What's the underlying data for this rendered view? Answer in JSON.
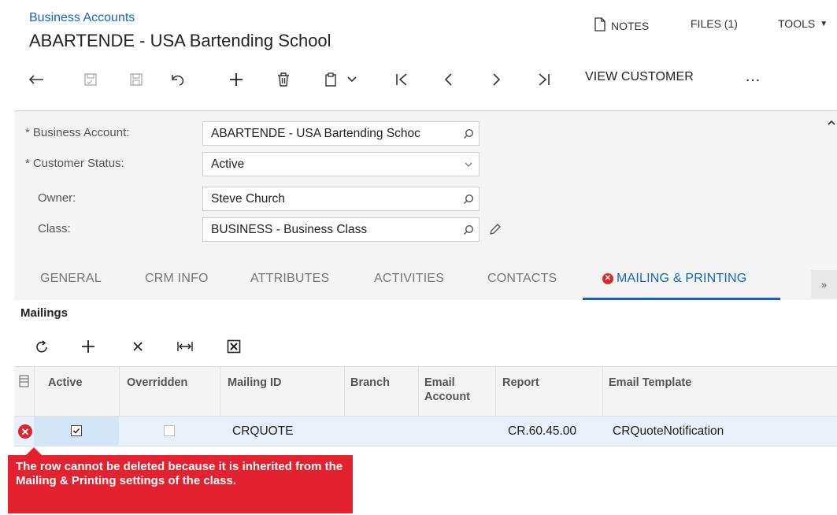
{
  "header": {
    "breadcrumb": "Business Accounts",
    "title": "ABARTENDE - USA Bartending School",
    "actions": {
      "notes": "NOTES",
      "files": "FILES (1)",
      "tools": "TOOLS"
    }
  },
  "toolbar": {
    "icons": [
      "back-arrow-icon",
      "save-and-close-icon",
      "save-icon",
      "undo-icon",
      "add-icon",
      "delete-icon",
      "copy-paste-icon",
      "first-record-icon",
      "previous-record-icon",
      "next-record-icon",
      "last-record-icon",
      "more-icon"
    ],
    "view_customer": "VIEW CUSTOMER",
    "more": "…"
  },
  "form": {
    "business_account": {
      "label": "Business Account:",
      "value": "ABARTENDE - USA Bartending Schoc"
    },
    "customer_status": {
      "label": "Customer Status:",
      "value": "Active"
    },
    "owner": {
      "label": "Owner:",
      "value": "Steve Church"
    },
    "class": {
      "label": "Class:",
      "value": "BUSINESS - Business Class"
    },
    "required_marker": "*"
  },
  "tabs": [
    {
      "label": "GENERAL",
      "active": false
    },
    {
      "label": "CRM INFO",
      "active": false
    },
    {
      "label": "ATTRIBUTES",
      "active": false
    },
    {
      "label": "ACTIVITIES",
      "active": false
    },
    {
      "label": "CONTACTS",
      "active": false
    },
    {
      "label": "MAILING & PRINTING",
      "active": true
    }
  ],
  "mailings": {
    "title": "Mailings",
    "tools": [
      "refresh-icon",
      "add-row-icon",
      "delete-row-icon",
      "fit-columns-icon",
      "export-excel-icon"
    ],
    "columns": [
      "Active",
      "Overridden",
      "Mailing ID",
      "Branch",
      "Email Account",
      "Report",
      "Email Template"
    ],
    "column_lines": {
      "email_account_1": "Email",
      "email_account_2": "Account"
    },
    "rows": [
      {
        "active": true,
        "overridden": false,
        "mailing_id": "CRQUOTE",
        "branch": "",
        "email_account": "",
        "report": "CR.60.45.00",
        "email_template": "CRQuoteNotification",
        "has_error": true
      }
    ],
    "error_message": "The row cannot be deleted because it is inherited from the Mailing & Printing settings of the class."
  },
  "colors": {
    "accent": "#1565c0",
    "error": "#e3212f",
    "row_selected": "#e8f1fa",
    "panel_bg": "#f4f4f4"
  }
}
